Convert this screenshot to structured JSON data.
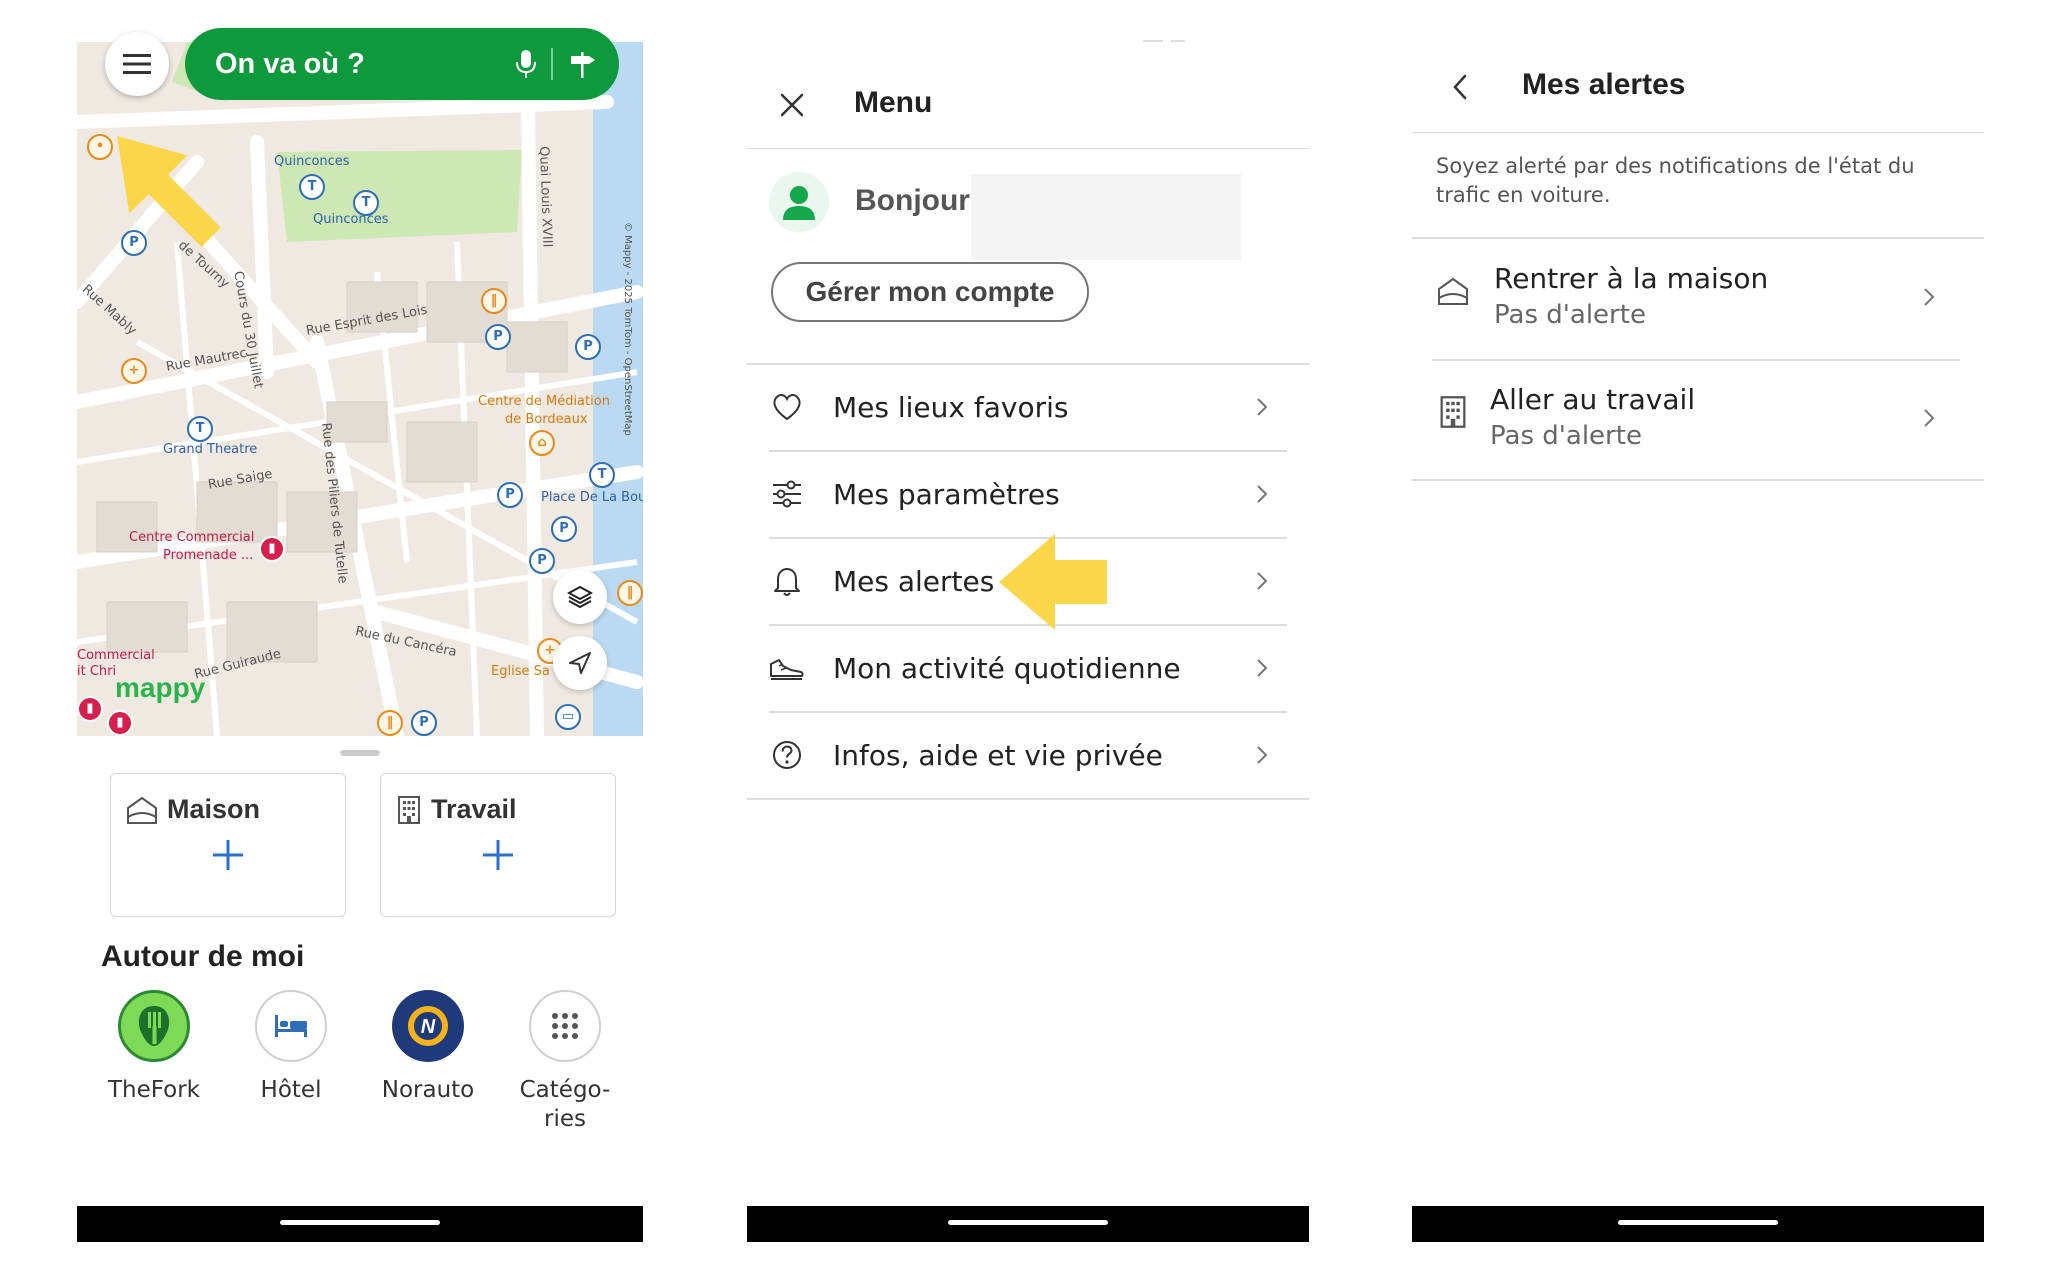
{
  "screen1": {
    "search": {
      "placeholder": "On va où ?"
    },
    "map": {
      "labels": {
        "quinconces_top": "Quinconces",
        "quinconces_bottom": "Quinconces",
        "cours": "Cours du 30 Juillet",
        "quai": "Quai Louis XVIII",
        "tourny": "de Tourny",
        "rue_esprit": "Rue Esprit des Lois",
        "rue_mautrec": "Rue Mautrec",
        "rue_mably": "Rue Mably",
        "grand_theatre": "Grand Theatre",
        "rue_saige": "Rue Saige",
        "centre_mediation": "Centre de Médiation",
        "de_bordeaux": "de Bordeaux",
        "place_bourse": "Place De La Bou",
        "centre_commercial": "Centre Commercial",
        "promenade": "Promenade ...",
        "rue_piliers": "Rue des Piliers de Tutelle",
        "rue_cancera": "Rue du Cancéra",
        "rue_guiraude": "Rue Guiraude",
        "commercial": "Commercial",
        "it_chri": "it Chri",
        "eglise": "Eglise Sa",
        "copyright": "© Mappy - 2025 TomTom - OpenStreetMap",
        "mappy": "mappy"
      }
    },
    "favorites": [
      {
        "label": "Maison",
        "icon": "home-icon"
      },
      {
        "label": "Travail",
        "icon": "building-icon"
      }
    ],
    "around_title": "Autour de moi",
    "around_items": [
      {
        "label": "TheFork",
        "icon": "thefork-icon",
        "color": "#7ed957"
      },
      {
        "label": "Hôtel",
        "icon": "bed-icon",
        "color": "#2f6db5"
      },
      {
        "label": "Norauto",
        "icon": "norauto-icon",
        "color": "#1f3a7a"
      },
      {
        "label": "Catégo-\nries",
        "icon": "grid-dots-icon",
        "color": "#555555"
      }
    ],
    "accent": "#0e9a3c"
  },
  "screen2": {
    "title": "Menu",
    "greeting": "Bonjour",
    "manage_account": "Gérer mon compte",
    "items": [
      {
        "label": "Mes lieux favoris",
        "icon": "heart-icon"
      },
      {
        "label": "Mes paramètres",
        "icon": "sliders-icon"
      },
      {
        "label": "Mes alertes",
        "icon": "bell-icon"
      },
      {
        "label": "Mon activité quotidienne",
        "icon": "shoe-icon"
      },
      {
        "label": "Infos, aide et vie privée",
        "icon": "help-circle-icon"
      }
    ],
    "highlight_color": "#fbd54a"
  },
  "screen3": {
    "title": "Mes alertes",
    "description": "Soyez alerté par des notifications de l'état du trafic en voiture.",
    "alerts": [
      {
        "title": "Rentrer à la maison",
        "status": "Pas d'alerte",
        "icon": "home-icon"
      },
      {
        "title": "Aller au travail",
        "status": "Pas d'alerte",
        "icon": "building-icon"
      }
    ]
  }
}
